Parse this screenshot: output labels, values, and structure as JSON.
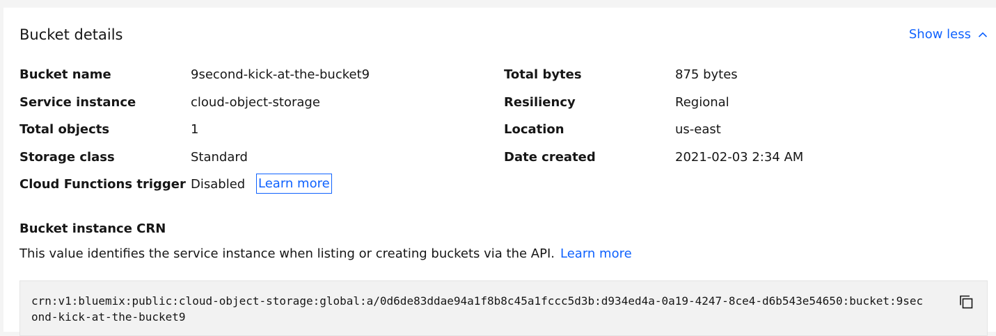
{
  "header": {
    "title": "Bucket details",
    "toggle_label": "Show less",
    "toggle_icon": "chevron-up-icon"
  },
  "details_left": [
    {
      "label": "Bucket name",
      "value": "9second-kick-at-the-bucket9"
    },
    {
      "label": "Service instance",
      "value": "cloud-object-storage"
    },
    {
      "label": "Total objects",
      "value": "1"
    },
    {
      "label": "Storage class",
      "value": "Standard"
    },
    {
      "label": "Cloud Functions trigger",
      "value": "Disabled",
      "link": "Learn more"
    }
  ],
  "details_right": [
    {
      "label": "Total bytes",
      "value": "875 bytes"
    },
    {
      "label": "Resiliency",
      "value": "Regional"
    },
    {
      "label": "Location",
      "value": "us-east"
    },
    {
      "label": "Date created",
      "value": "2021-02-03 2:34 AM"
    }
  ],
  "crn": {
    "heading": "Bucket instance CRN",
    "description": "This value identifies the service instance when listing or creating buckets via the API.",
    "learn_more": "Learn more",
    "value": "crn:v1:bluemix:public:cloud-object-storage:global:a/0d6de83ddae94a1f8b8c45a1fccc5d3b:d934ed4a-0a19-4247-8ce4-d6b543e54650:bucket:9second-kick-at-the-bucket9",
    "copy_icon": "copy-icon"
  },
  "colors": {
    "link": "#0f62fe",
    "text": "#161616",
    "background": "#f4f4f4",
    "card": "#ffffff",
    "code_background": "#f2f2f2"
  }
}
